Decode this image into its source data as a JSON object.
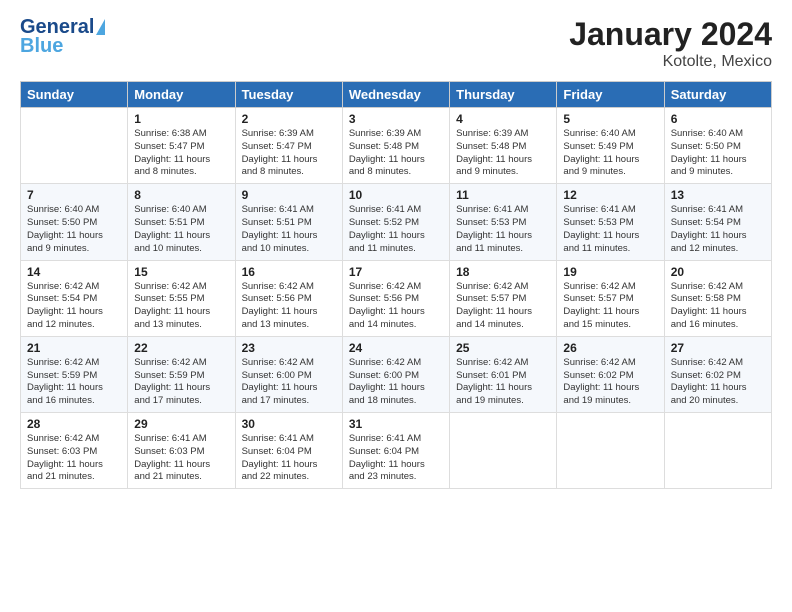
{
  "logo": {
    "line1": "General",
    "line2": "Blue"
  },
  "title": "January 2024",
  "subtitle": "Kotolte, Mexico",
  "days_of_week": [
    "Sunday",
    "Monday",
    "Tuesday",
    "Wednesday",
    "Thursday",
    "Friday",
    "Saturday"
  ],
  "weeks": [
    [
      {
        "num": "",
        "info": ""
      },
      {
        "num": "1",
        "info": "Sunrise: 6:38 AM\nSunset: 5:47 PM\nDaylight: 11 hours\nand 8 minutes."
      },
      {
        "num": "2",
        "info": "Sunrise: 6:39 AM\nSunset: 5:47 PM\nDaylight: 11 hours\nand 8 minutes."
      },
      {
        "num": "3",
        "info": "Sunrise: 6:39 AM\nSunset: 5:48 PM\nDaylight: 11 hours\nand 8 minutes."
      },
      {
        "num": "4",
        "info": "Sunrise: 6:39 AM\nSunset: 5:48 PM\nDaylight: 11 hours\nand 9 minutes."
      },
      {
        "num": "5",
        "info": "Sunrise: 6:40 AM\nSunset: 5:49 PM\nDaylight: 11 hours\nand 9 minutes."
      },
      {
        "num": "6",
        "info": "Sunrise: 6:40 AM\nSunset: 5:50 PM\nDaylight: 11 hours\nand 9 minutes."
      }
    ],
    [
      {
        "num": "7",
        "info": "Sunrise: 6:40 AM\nSunset: 5:50 PM\nDaylight: 11 hours\nand 9 minutes."
      },
      {
        "num": "8",
        "info": "Sunrise: 6:40 AM\nSunset: 5:51 PM\nDaylight: 11 hours\nand 10 minutes."
      },
      {
        "num": "9",
        "info": "Sunrise: 6:41 AM\nSunset: 5:51 PM\nDaylight: 11 hours\nand 10 minutes."
      },
      {
        "num": "10",
        "info": "Sunrise: 6:41 AM\nSunset: 5:52 PM\nDaylight: 11 hours\nand 11 minutes."
      },
      {
        "num": "11",
        "info": "Sunrise: 6:41 AM\nSunset: 5:53 PM\nDaylight: 11 hours\nand 11 minutes."
      },
      {
        "num": "12",
        "info": "Sunrise: 6:41 AM\nSunset: 5:53 PM\nDaylight: 11 hours\nand 11 minutes."
      },
      {
        "num": "13",
        "info": "Sunrise: 6:41 AM\nSunset: 5:54 PM\nDaylight: 11 hours\nand 12 minutes."
      }
    ],
    [
      {
        "num": "14",
        "info": "Sunrise: 6:42 AM\nSunset: 5:54 PM\nDaylight: 11 hours\nand 12 minutes."
      },
      {
        "num": "15",
        "info": "Sunrise: 6:42 AM\nSunset: 5:55 PM\nDaylight: 11 hours\nand 13 minutes."
      },
      {
        "num": "16",
        "info": "Sunrise: 6:42 AM\nSunset: 5:56 PM\nDaylight: 11 hours\nand 13 minutes."
      },
      {
        "num": "17",
        "info": "Sunrise: 6:42 AM\nSunset: 5:56 PM\nDaylight: 11 hours\nand 14 minutes."
      },
      {
        "num": "18",
        "info": "Sunrise: 6:42 AM\nSunset: 5:57 PM\nDaylight: 11 hours\nand 14 minutes."
      },
      {
        "num": "19",
        "info": "Sunrise: 6:42 AM\nSunset: 5:57 PM\nDaylight: 11 hours\nand 15 minutes."
      },
      {
        "num": "20",
        "info": "Sunrise: 6:42 AM\nSunset: 5:58 PM\nDaylight: 11 hours\nand 16 minutes."
      }
    ],
    [
      {
        "num": "21",
        "info": "Sunrise: 6:42 AM\nSunset: 5:59 PM\nDaylight: 11 hours\nand 16 minutes."
      },
      {
        "num": "22",
        "info": "Sunrise: 6:42 AM\nSunset: 5:59 PM\nDaylight: 11 hours\nand 17 minutes."
      },
      {
        "num": "23",
        "info": "Sunrise: 6:42 AM\nSunset: 6:00 PM\nDaylight: 11 hours\nand 17 minutes."
      },
      {
        "num": "24",
        "info": "Sunrise: 6:42 AM\nSunset: 6:00 PM\nDaylight: 11 hours\nand 18 minutes."
      },
      {
        "num": "25",
        "info": "Sunrise: 6:42 AM\nSunset: 6:01 PM\nDaylight: 11 hours\nand 19 minutes."
      },
      {
        "num": "26",
        "info": "Sunrise: 6:42 AM\nSunset: 6:02 PM\nDaylight: 11 hours\nand 19 minutes."
      },
      {
        "num": "27",
        "info": "Sunrise: 6:42 AM\nSunset: 6:02 PM\nDaylight: 11 hours\nand 20 minutes."
      }
    ],
    [
      {
        "num": "28",
        "info": "Sunrise: 6:42 AM\nSunset: 6:03 PM\nDaylight: 11 hours\nand 21 minutes."
      },
      {
        "num": "29",
        "info": "Sunrise: 6:41 AM\nSunset: 6:03 PM\nDaylight: 11 hours\nand 21 minutes."
      },
      {
        "num": "30",
        "info": "Sunrise: 6:41 AM\nSunset: 6:04 PM\nDaylight: 11 hours\nand 22 minutes."
      },
      {
        "num": "31",
        "info": "Sunrise: 6:41 AM\nSunset: 6:04 PM\nDaylight: 11 hours\nand 23 minutes."
      },
      {
        "num": "",
        "info": ""
      },
      {
        "num": "",
        "info": ""
      },
      {
        "num": "",
        "info": ""
      }
    ]
  ]
}
